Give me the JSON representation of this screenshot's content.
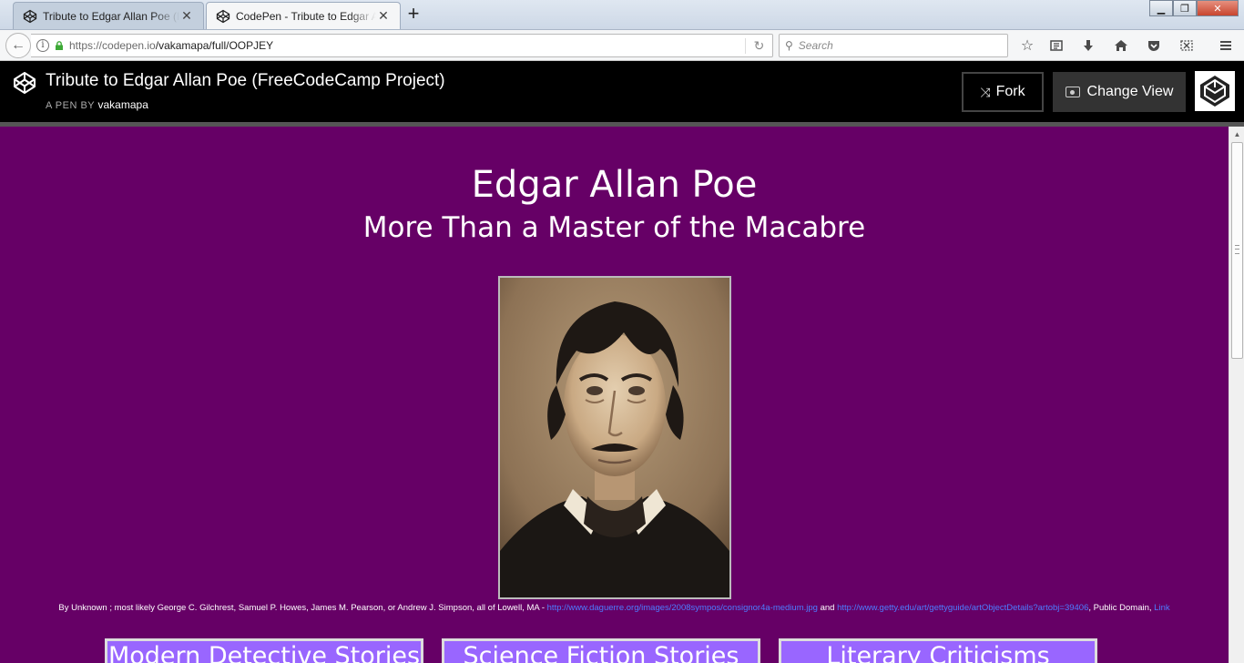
{
  "browser": {
    "tabs": [
      {
        "title": "Tribute to Edgar Allan Poe (F",
        "active": false,
        "close": "✕"
      },
      {
        "title": "CodePen - Tribute to Edgar A",
        "active": true,
        "close": "✕"
      }
    ],
    "new_tab_glyph": "+",
    "window_controls": {
      "minimize": "▁",
      "maximize": "❐",
      "close": "✕"
    },
    "url_host": "https://codepen.io",
    "url_path": "/vakamapa/full/OOPJEY",
    "search_placeholder": "Search",
    "nav_icons": [
      "bookmark-star-icon",
      "reader-list-icon",
      "download-icon",
      "home-icon",
      "pocket-icon",
      "screenshot-icon",
      "menu-icon"
    ]
  },
  "codepen": {
    "pen_title": "Tribute to Edgar Allan Poe (FreeCodeCamp Project)",
    "byline_prefix": "A PEN BY",
    "author": "vakamapa",
    "fork_label": "Fork",
    "change_view_label": "Change View"
  },
  "page": {
    "background": "#660066",
    "heading": "Edgar Allan Poe",
    "subheading": "More Than a Master of the Macabre",
    "caption": {
      "text_1": "By Unknown ; most likely George C. Gilchrest, Samuel P. Howes, James M. Pearson, or Andrew J. Simpson, all of Lowell, MA - ",
      "link_1": "http://www.daguerre.org/images/2008sympos/consignor4a-medium.jpg",
      "text_2": " and ",
      "link_2": "http://www.getty.edu/art/gettyguide/artObjectDetails?artobj=39406",
      "text_3": ", Public Domain, ",
      "link_3": "Link"
    },
    "nav_boxes": [
      "Modern Detective Stories",
      "Science Fiction Stories",
      "Literary Criticisms"
    ],
    "nav_box_color": "#9966ff"
  }
}
